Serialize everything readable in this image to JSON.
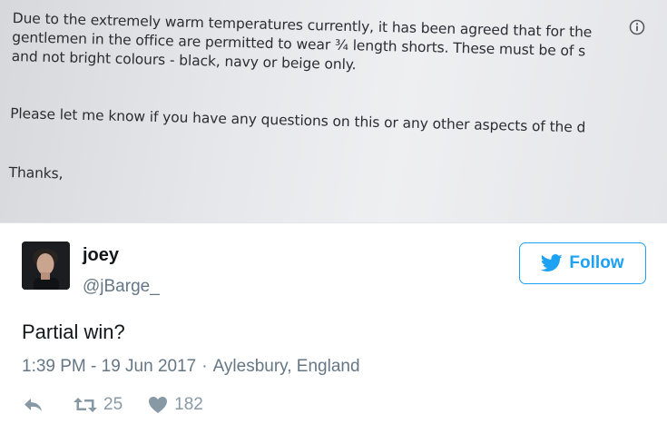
{
  "photo": {
    "lines": [
      "Due to the extremely warm temperatures currently, it has been agreed that for the",
      "gentlemen in the office are permitted to wear ¾ length shorts. These must be of s",
      "and not bright colours - black, navy or beige only.",
      "Please let me know if you have any questions on this or any other aspects of the d",
      "Thanks,"
    ]
  },
  "tweet": {
    "display_name": "joey",
    "handle": "@jBarge_",
    "follow_label": "Follow",
    "text": "Partial win?",
    "time": "1:39 PM - 19 Jun 2017",
    "separator": "·",
    "location": "Aylesbury, England",
    "retweets": "25",
    "likes": "182"
  },
  "colors": {
    "brand": "#1da1f2",
    "text": "#14171a",
    "secondary": "#657786",
    "action_icons": "#8899a6"
  },
  "icons": [
    "info-icon",
    "twitter-bird-icon",
    "reply-icon",
    "retweet-icon",
    "heart-icon"
  ]
}
